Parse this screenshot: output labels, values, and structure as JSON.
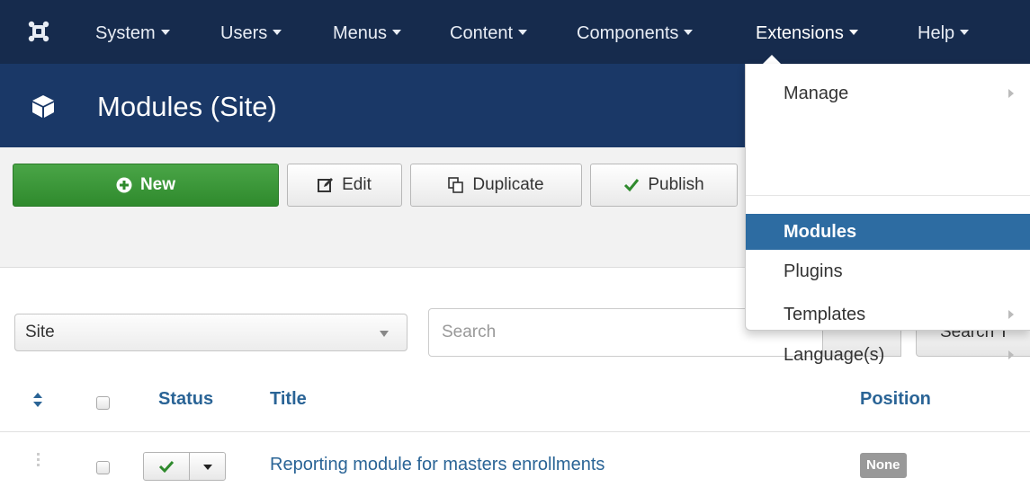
{
  "nav": {
    "items": [
      {
        "label": "System"
      },
      {
        "label": "Users"
      },
      {
        "label": "Menus"
      },
      {
        "label": "Content"
      },
      {
        "label": "Components"
      },
      {
        "label": "Extensions"
      },
      {
        "label": "Help"
      }
    ]
  },
  "header": {
    "title": "Modules (Site)",
    "icon": "cube-icon"
  },
  "toolbar": {
    "new_label": "New",
    "edit_label": "Edit",
    "duplicate_label": "Duplicate",
    "publish_label": "Publish"
  },
  "filters": {
    "client_select": "Site",
    "search_placeholder": "Search",
    "search_tools_label": "Search T"
  },
  "table": {
    "headers": {
      "status": "Status",
      "title": "Title",
      "position": "Position"
    },
    "rows": [
      {
        "title": "Reporting module for masters enrollments",
        "position": "None",
        "published": true
      }
    ]
  },
  "dropdown": {
    "items": [
      {
        "label": "Manage",
        "submenu": true
      },
      {
        "label": "Modules",
        "active": true
      },
      {
        "label": "Plugins"
      },
      {
        "label": "Templates",
        "submenu": true
      },
      {
        "label": "Language(s)",
        "submenu": true
      }
    ]
  },
  "colors": {
    "nav_bg": "#162b4d",
    "header_bg": "#1a3867",
    "new_button": "#3b9b38",
    "link": "#2a6496",
    "menu_active": "#2d6ca2"
  }
}
